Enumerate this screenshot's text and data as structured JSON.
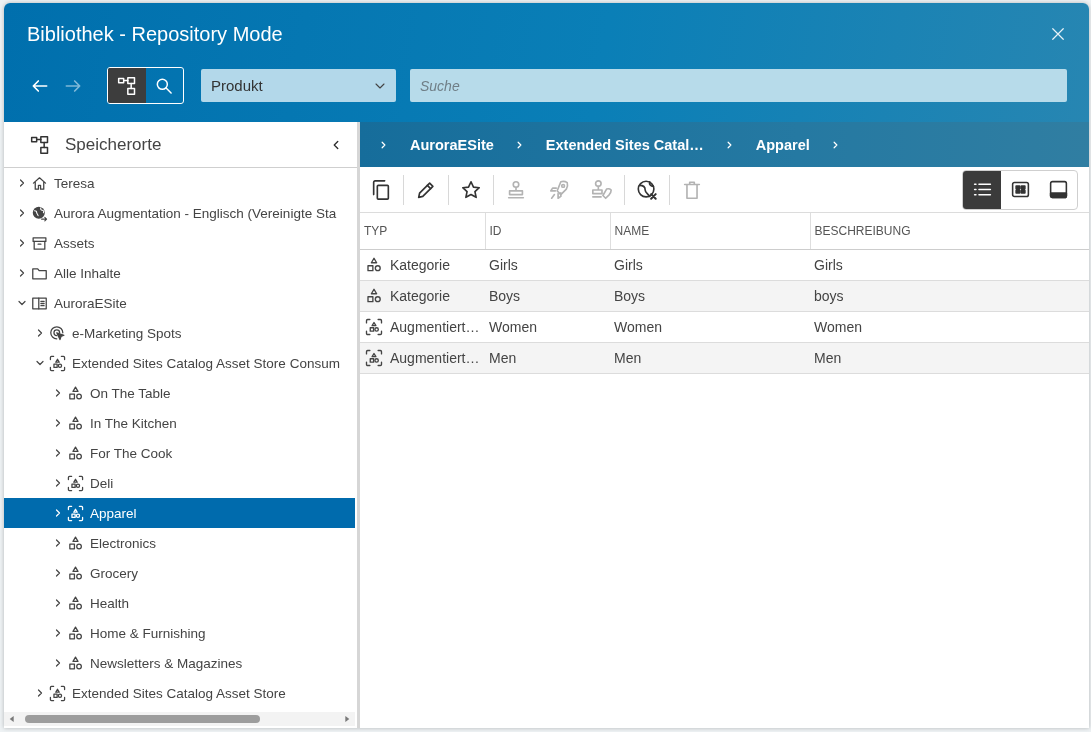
{
  "window": {
    "title": "Bibliothek - Repository Mode"
  },
  "nav_buttons": [
    {
      "kind": "back",
      "disabled": false
    },
    {
      "kind": "forward",
      "disabled": true
    }
  ],
  "mode_toggle": [
    {
      "kind": "tree",
      "selected": true
    },
    {
      "kind": "search",
      "selected": false
    }
  ],
  "type_dropdown": {
    "value": "Produkt"
  },
  "search": {
    "placeholder": "Suche"
  },
  "sidebar": {
    "title": "Speicherorte",
    "tree": [
      {
        "label": "Teresa",
        "kind": "home",
        "expanded": false,
        "selected": false
      },
      {
        "label": "Aurora Augmentation - Englisch (Vereinigte Sta",
        "kind": "globe",
        "expanded": false,
        "selected": false
      },
      {
        "label": "Assets",
        "kind": "archive",
        "expanded": false,
        "selected": false
      },
      {
        "label": "Alle Inhalte",
        "kind": "folder",
        "expanded": false,
        "selected": false
      },
      {
        "label": "AuroraESite",
        "kind": "catalog",
        "expanded": true,
        "selected": false,
        "children": [
          {
            "label": "e-Marketing Spots",
            "kind": "spots",
            "expanded": false,
            "selected": false
          },
          {
            "label": "Extended Sites Catalog Asset Store Consum",
            "kind": "augmented",
            "expanded": true,
            "selected": false,
            "children": [
              {
                "label": "On The Table",
                "kind": "category",
                "expanded": false,
                "selected": false
              },
              {
                "label": "In The Kitchen",
                "kind": "category",
                "expanded": false,
                "selected": false
              },
              {
                "label": "For The Cook",
                "kind": "category",
                "expanded": false,
                "selected": false
              },
              {
                "label": "Deli",
                "kind": "augmented",
                "expanded": false,
                "selected": false
              },
              {
                "label": "Apparel",
                "kind": "augmented",
                "expanded": false,
                "selected": true
              },
              {
                "label": "Electronics",
                "kind": "category",
                "expanded": false,
                "selected": false
              },
              {
                "label": "Grocery",
                "kind": "category",
                "expanded": false,
                "selected": false
              },
              {
                "label": "Health",
                "kind": "category",
                "expanded": false,
                "selected": false
              },
              {
                "label": "Home & Furnishing",
                "kind": "category",
                "expanded": false,
                "selected": false
              },
              {
                "label": "Newsletters & Magazines",
                "kind": "category",
                "expanded": false,
                "selected": false
              }
            ]
          },
          {
            "label": "Extended Sites Catalog Asset Store",
            "kind": "augmented",
            "expanded": false,
            "selected": false
          }
        ]
      }
    ]
  },
  "breadcrumb": [
    "AuroraESite",
    "Extended Sites Catal…",
    "Apparel"
  ],
  "action_groups": [
    [
      {
        "kind": "copy",
        "disabled": false
      }
    ],
    [
      {
        "kind": "edit",
        "disabled": false
      }
    ],
    [
      {
        "kind": "favorite",
        "disabled": false
      }
    ],
    [
      {
        "kind": "stamp",
        "disabled": true
      },
      {
        "kind": "rocket",
        "disabled": true
      },
      {
        "kind": "stamp_rocket",
        "disabled": true
      }
    ],
    [
      {
        "kind": "globe_x",
        "disabled": false
      }
    ],
    [
      {
        "kind": "delete",
        "disabled": true
      }
    ]
  ],
  "view_modes": [
    {
      "kind": "list",
      "selected": true
    },
    {
      "kind": "grid",
      "selected": false
    },
    {
      "kind": "panel",
      "selected": false
    }
  ],
  "table": {
    "columns": [
      "TYP",
      "ID",
      "NAME",
      "BESCHREIBUNG"
    ],
    "rows": [
      {
        "kind": "category",
        "cells": [
          "Kategorie",
          "Girls",
          "Girls",
          "Girls"
        ]
      },
      {
        "kind": "category",
        "cells": [
          "Kategorie",
          "Boys",
          "Boys",
          "boys"
        ]
      },
      {
        "kind": "augmented",
        "cells": [
          "Augmentiert…",
          "Women",
          "Women",
          "Women"
        ]
      },
      {
        "kind": "augmented",
        "cells": [
          "Augmentiert…",
          "Men",
          "Men",
          "Men"
        ]
      }
    ]
  }
}
